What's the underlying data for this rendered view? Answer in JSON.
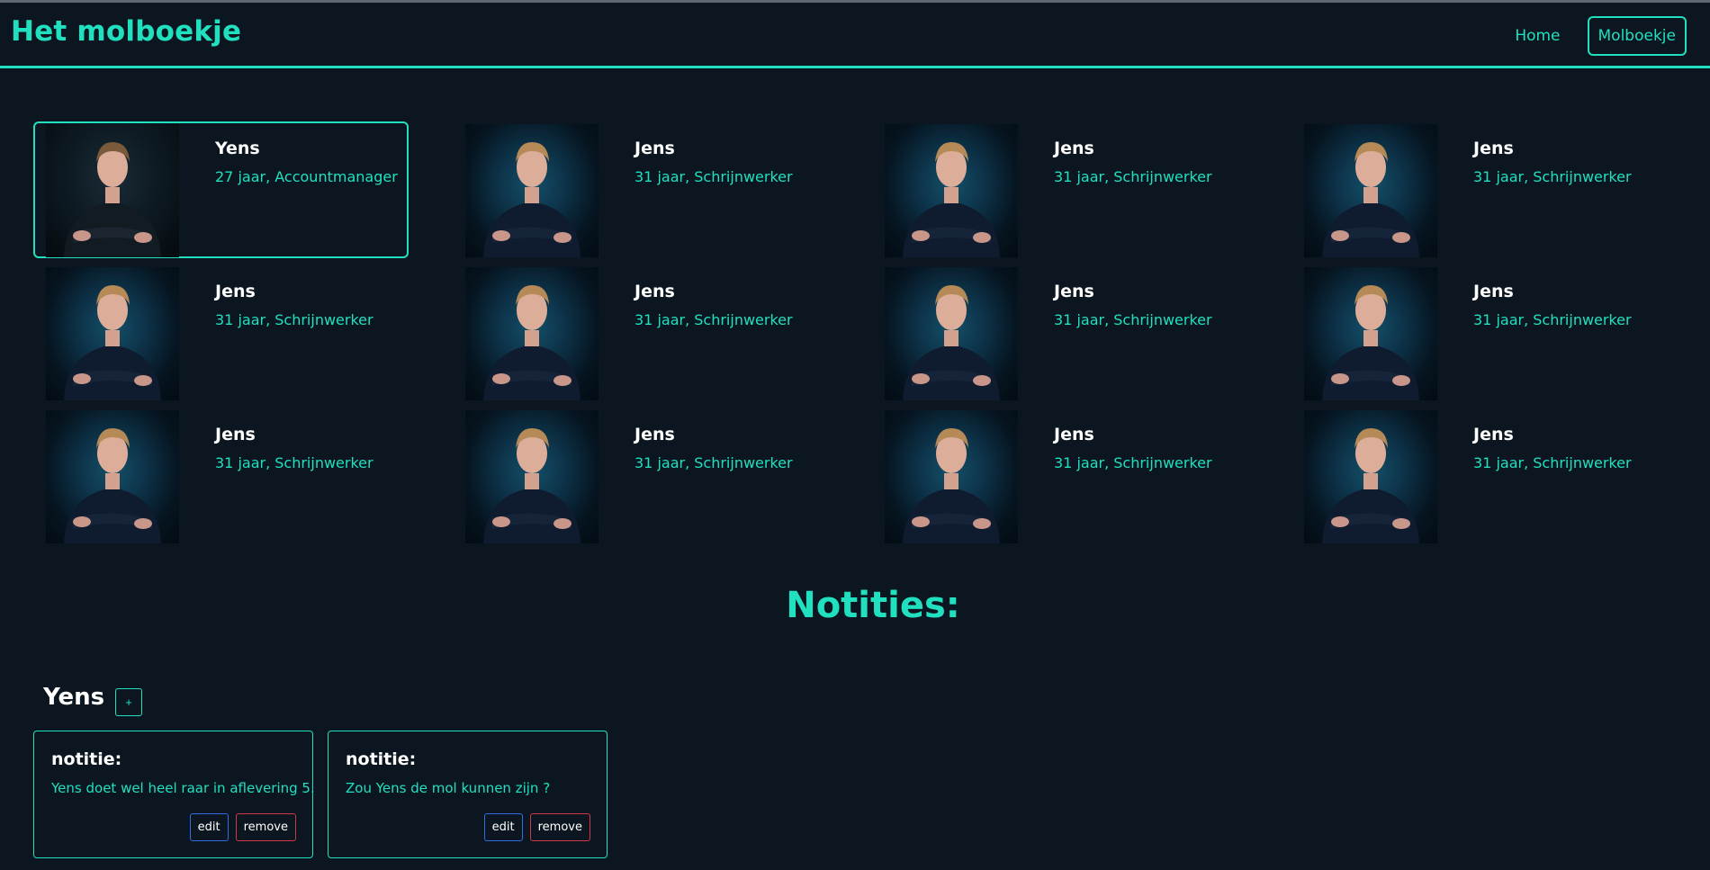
{
  "header": {
    "brand": "Het molboekje",
    "nav": [
      {
        "label": "Home",
        "active": false
      },
      {
        "label": "Molboekje",
        "active": true
      }
    ]
  },
  "colors": {
    "accent": "#21e0bf",
    "background": "#0b1620",
    "edit_border": "#2f6de0",
    "remove_border": "#d0384a"
  },
  "candidates": [
    {
      "name": "Yens",
      "info": "27 jaar, Accountmanager",
      "selected": true,
      "photo": "person-portrait-icon"
    },
    {
      "name": "Jens",
      "info": "31 jaar, Schrijnwerker",
      "selected": false,
      "photo": "person-portrait-icon"
    },
    {
      "name": "Jens",
      "info": "31 jaar, Schrijnwerker",
      "selected": false,
      "photo": "person-portrait-icon"
    },
    {
      "name": "Jens",
      "info": "31 jaar, Schrijnwerker",
      "selected": false,
      "photo": "person-portrait-icon"
    },
    {
      "name": "Jens",
      "info": "31 jaar, Schrijnwerker",
      "selected": false,
      "photo": "person-portrait-icon"
    },
    {
      "name": "Jens",
      "info": "31 jaar, Schrijnwerker",
      "selected": false,
      "photo": "person-portrait-icon"
    },
    {
      "name": "Jens",
      "info": "31 jaar, Schrijnwerker",
      "selected": false,
      "photo": "person-portrait-icon"
    },
    {
      "name": "Jens",
      "info": "31 jaar, Schrijnwerker",
      "selected": false,
      "photo": "person-portrait-icon"
    },
    {
      "name": "Jens",
      "info": "31 jaar, Schrijnwerker",
      "selected": false,
      "photo": "person-portrait-icon"
    },
    {
      "name": "Jens",
      "info": "31 jaar, Schrijnwerker",
      "selected": false,
      "photo": "person-portrait-icon"
    },
    {
      "name": "Jens",
      "info": "31 jaar, Schrijnwerker",
      "selected": false,
      "photo": "person-portrait-icon"
    },
    {
      "name": "Jens",
      "info": "31 jaar, Schrijnwerker",
      "selected": false,
      "photo": "person-portrait-icon"
    }
  ],
  "notes": {
    "title": "Notities:",
    "candidate_name": "Yens",
    "add_label": "+",
    "items": [
      {
        "heading": "notitie:",
        "text": "Yens doet wel heel raar in aflevering 5.",
        "edit_label": "edit",
        "remove_label": "remove"
      },
      {
        "heading": "notitie:",
        "text": "Zou Yens de mol kunnen zijn ?",
        "edit_label": "edit",
        "remove_label": "remove"
      }
    ]
  }
}
